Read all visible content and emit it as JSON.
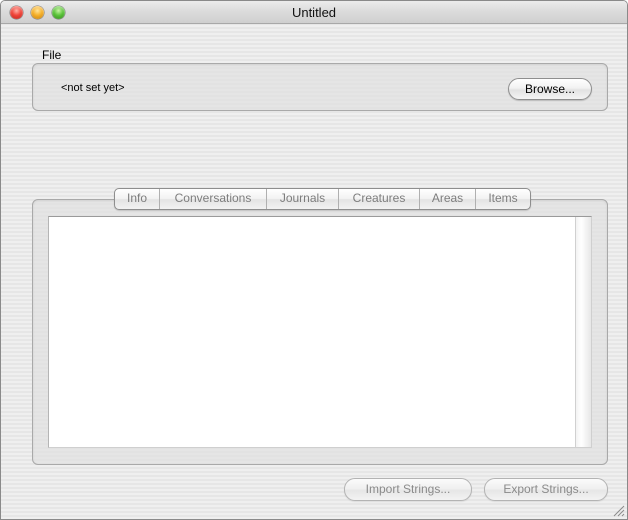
{
  "window": {
    "title": "Untitled"
  },
  "file_section": {
    "label": "File",
    "path": "<not set yet>",
    "browse_label": "Browse..."
  },
  "tabs": [
    {
      "label": "Info",
      "state": "disabled"
    },
    {
      "label": "Conversations",
      "state": "disabled"
    },
    {
      "label": "Journals",
      "state": "disabled"
    },
    {
      "label": "Creatures",
      "state": "disabled"
    },
    {
      "label": "Areas",
      "state": "disabled"
    },
    {
      "label": "Items",
      "state": "disabled"
    }
  ],
  "footer": {
    "import_label": "Import Strings...",
    "export_label": "Export Strings..."
  },
  "icons": {
    "close": "close-button-icon",
    "minimize": "minimize-button-icon",
    "zoom": "zoom-button-icon",
    "resize": "resize-grip-icon"
  }
}
